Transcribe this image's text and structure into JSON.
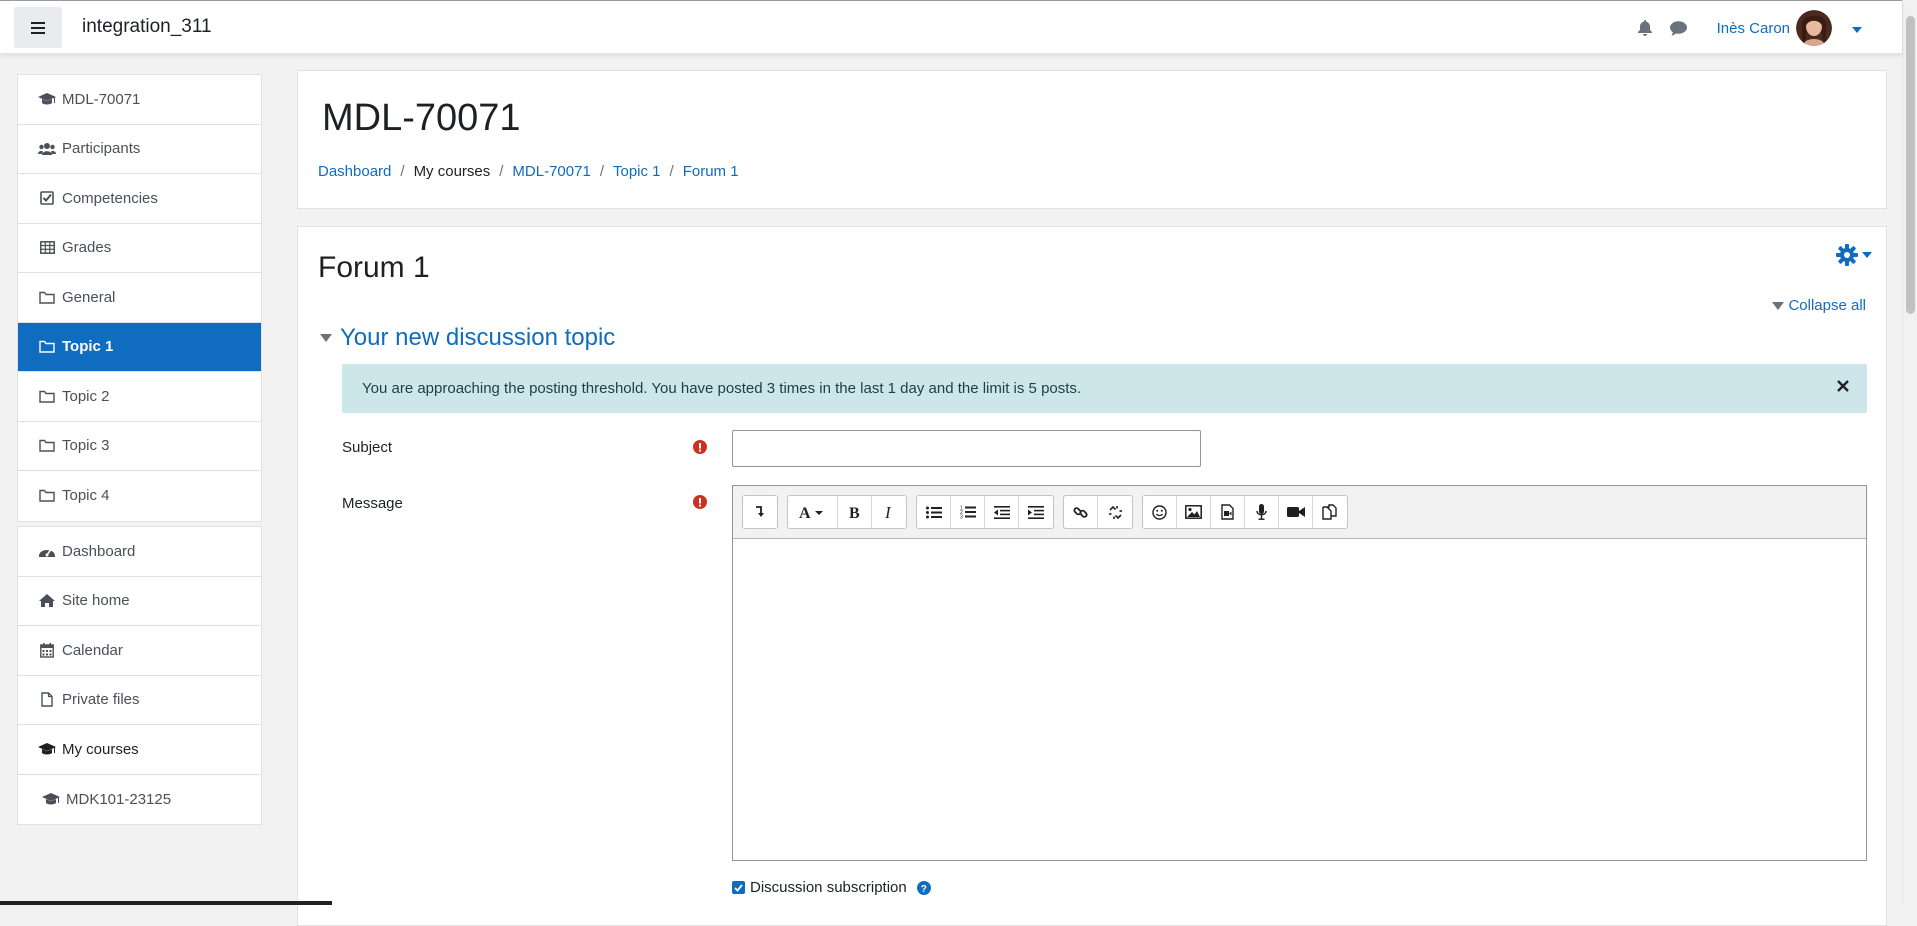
{
  "header": {
    "site_name": "integration_311",
    "user_name": "Inès Caron"
  },
  "sidebar": {
    "course_items": [
      {
        "label": "MDL-70071",
        "icon": "graduation-cap-icon"
      },
      {
        "label": "Participants",
        "icon": "users-icon"
      },
      {
        "label": "Competencies",
        "icon": "check-square-icon"
      },
      {
        "label": "Grades",
        "icon": "table-icon"
      },
      {
        "label": "General",
        "icon": "folder-icon"
      },
      {
        "label": "Topic 1",
        "icon": "folder-icon"
      },
      {
        "label": "Topic 2",
        "icon": "folder-icon"
      },
      {
        "label": "Topic 3",
        "icon": "folder-icon"
      },
      {
        "label": "Topic 4",
        "icon": "folder-icon"
      }
    ],
    "site_items": [
      {
        "label": "Dashboard",
        "icon": "tachometer-icon"
      },
      {
        "label": "Site home",
        "icon": "home-icon"
      },
      {
        "label": "Calendar",
        "icon": "calendar-icon"
      },
      {
        "label": "Private files",
        "icon": "file-icon"
      },
      {
        "label": "My courses",
        "icon": "graduation-cap-icon"
      },
      {
        "label": "MDK101-23125",
        "icon": "graduation-cap-icon"
      }
    ],
    "active": "Topic 1"
  },
  "page": {
    "title": "MDL-70071",
    "breadcrumb": [
      "Dashboard",
      "My courses",
      "MDL-70071",
      "Topic 1",
      "Forum 1"
    ]
  },
  "main": {
    "activity_title": "Forum 1",
    "collapse_all": "Collapse all",
    "section_title": "Your new discussion topic",
    "alert_text": "You are approaching the posting threshold. You have posted 3 times in the last 1 day and the limit is 5 posts.",
    "subject_label": "Subject",
    "subject_value": "",
    "message_label": "Message",
    "subscription_label": "Discussion subscription",
    "subscription_checked": true
  },
  "colors": {
    "accent": "#0f6cbf",
    "alert_bg": "#cce6ea",
    "required": "#ca3120"
  }
}
